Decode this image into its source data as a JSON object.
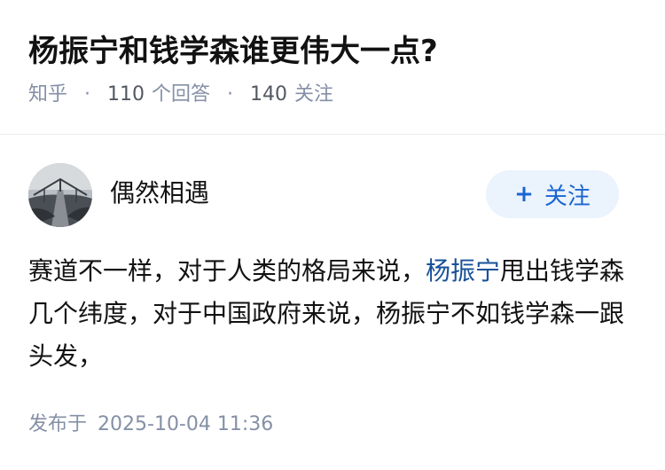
{
  "question": {
    "title": "杨振宁和钱学森谁更伟大一点?",
    "source": "知乎",
    "answer_count": "110",
    "answer_label": "个回答",
    "follower_count": "140",
    "follower_label": "关注",
    "separator": "·"
  },
  "author": {
    "name": "偶然相遇",
    "avatar_icon": "bridge-photo-avatar",
    "follow_button": {
      "icon": "+",
      "label": "关注"
    }
  },
  "answer": {
    "text_before_link": "赛道不一样，对于人类的格局来说，",
    "link_text": "杨振宁",
    "text_after_link": "甩出钱学森几个纬度，对于中国政府来说，杨振宁不如钱学森一跟头发，"
  },
  "publish": {
    "label": "发布于",
    "datetime": "2025-10-04 11:36"
  },
  "colors": {
    "meta_gray": "#8590a6",
    "link_blue": "#175199",
    "follow_bg": "#ebf3fd",
    "follow_text": "#1a66d1"
  }
}
